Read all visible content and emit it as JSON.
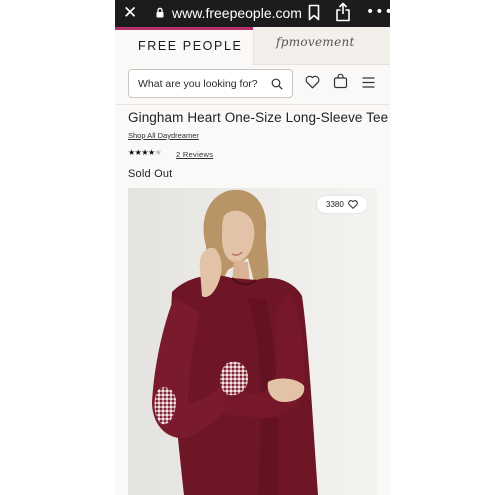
{
  "browser": {
    "url": "www.freepeople.com"
  },
  "brand_tabs": {
    "primary": "FREE PEOPLE",
    "secondary": "fpmovement"
  },
  "search": {
    "placeholder": "What are you looking for?"
  },
  "product": {
    "title": "Gingham Heart One-Size Long-Sleeve Tee",
    "collection_link": "Shop All Daydreamer",
    "rating": 4,
    "rating_max": 5,
    "reviews_link": "2 Reviews",
    "availability": "Sold Out",
    "favorites_count": "3380"
  },
  "colors": {
    "brand_accent": "#b8306a",
    "shirt": "#6e1526"
  },
  "icons": [
    "close-icon",
    "lock-icon",
    "bookmark-icon",
    "share-icon",
    "more-icon",
    "search-icon",
    "heart-icon",
    "bag-icon",
    "menu-icon"
  ]
}
